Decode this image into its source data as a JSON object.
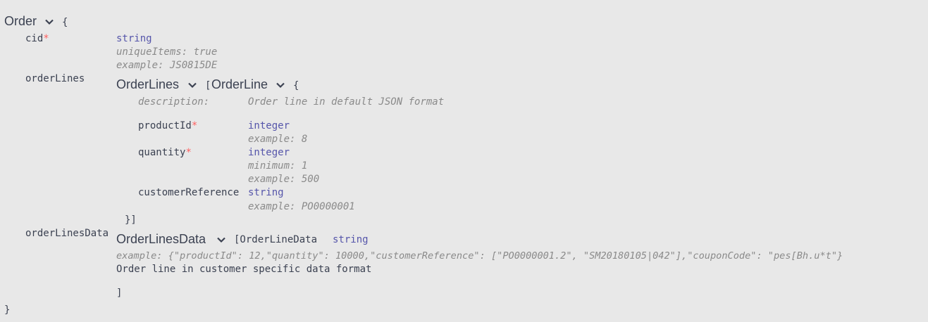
{
  "order": {
    "title": "Order",
    "open_brace": "{",
    "close_brace": "}",
    "icon": "chevron-down-icon"
  },
  "cid": {
    "name": "cid",
    "required": "*",
    "type": "string",
    "unique": "uniqueItems: true",
    "example": "example: JS0815DE"
  },
  "orderLines": {
    "name": "orderLines",
    "model_title": "OrderLines",
    "open_bracket": "[",
    "item_title": "OrderLine",
    "open_brace": "{",
    "close": "}]",
    "description_label": "description:",
    "description_value": "Order line in default JSON format",
    "props": {
      "productId": {
        "name": "productId",
        "required": "*",
        "type": "integer",
        "example": "example: 8"
      },
      "quantity": {
        "name": "quantity",
        "required": "*",
        "type": "integer",
        "minimum": "minimum: 1",
        "example": "example: 500"
      },
      "customerReference": {
        "name": "customerReference",
        "type": "string",
        "example": "example: PO0000001"
      }
    }
  },
  "orderLinesData": {
    "name": "orderLinesData",
    "model_title": "OrderLinesData",
    "inline": "[OrderLineData",
    "type": "string",
    "example": "example: {\"productId\": 12,\"quantity\": 10000,\"customerReference\": [\"PO0000001.2\", \"SM20180105|042\"],\"couponCode\": \"pes[Bh.u*t\"}",
    "description": "Order line in customer specific data format",
    "close": "]"
  }
}
